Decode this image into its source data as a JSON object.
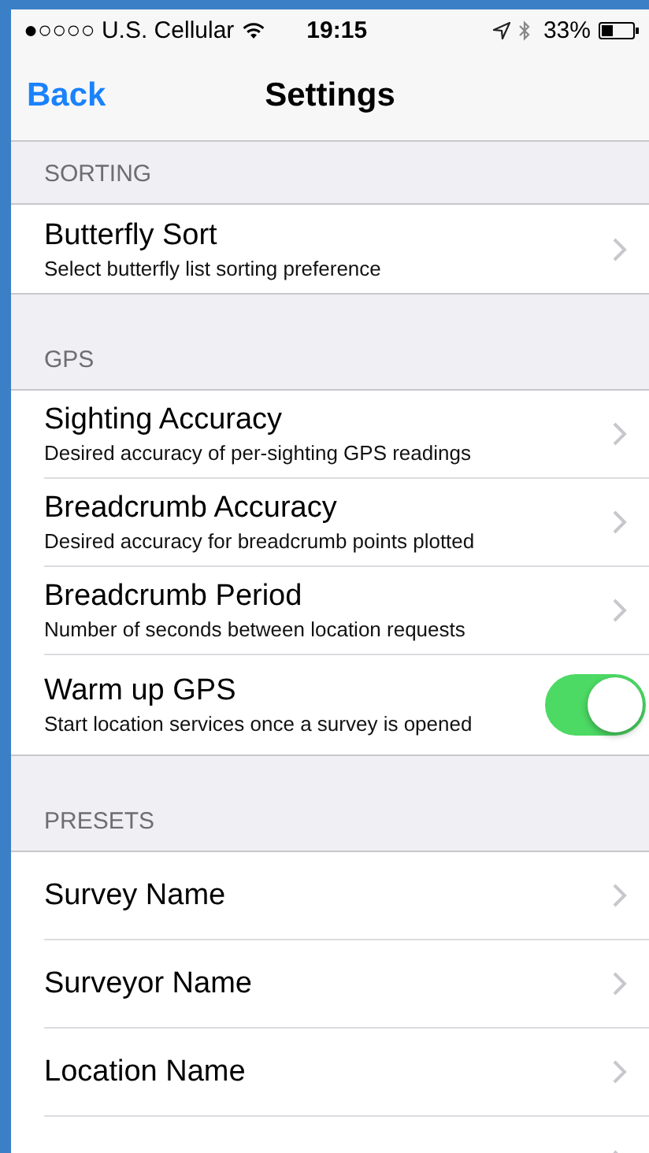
{
  "status_bar": {
    "carrier": "●○○○○ U.S. Cellular",
    "time": "19:15",
    "battery": "33%"
  },
  "nav_bar": {
    "back": "Back",
    "title": "Settings"
  },
  "sections": [
    {
      "header": "SORTING",
      "rows": [
        {
          "kind": "nav",
          "title": "Butterfly Sort",
          "subtitle": "Select butterfly list sorting preference"
        }
      ]
    },
    {
      "header": "GPS",
      "rows": [
        {
          "kind": "nav",
          "title": "Sighting Accuracy",
          "subtitle": "Desired accuracy of per-sighting GPS readings"
        },
        {
          "kind": "nav",
          "title": "Breadcrumb Accuracy",
          "subtitle": "Desired accuracy for breadcrumb points plotted"
        },
        {
          "kind": "nav",
          "title": "Breadcrumb Period",
          "subtitle": "Number of seconds between location requests"
        },
        {
          "kind": "toggle",
          "title": "Warm up GPS",
          "subtitle": "Start location services once a survey is opened",
          "on": true
        }
      ]
    },
    {
      "header": "PRESETS",
      "rows": [
        {
          "kind": "nav",
          "title": "Survey Name"
        },
        {
          "kind": "nav",
          "title": "Surveyor Name"
        },
        {
          "kind": "nav",
          "title": "Location Name"
        },
        {
          "kind": "nav"
        }
      ]
    }
  ]
}
